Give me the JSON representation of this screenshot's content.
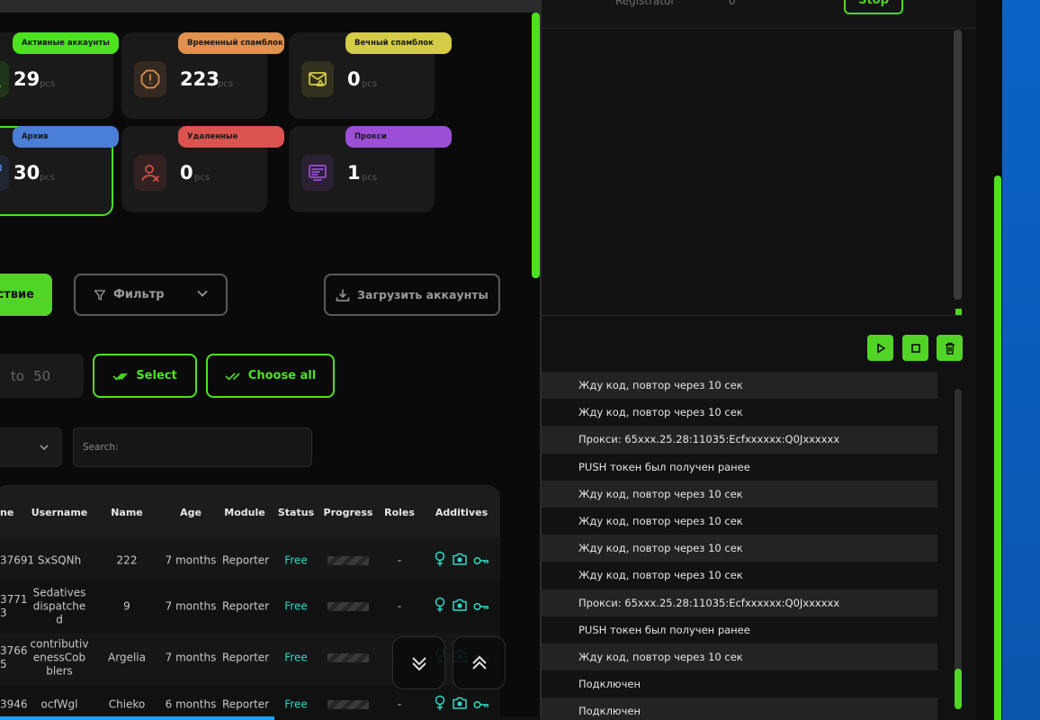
{
  "background_window": {
    "header_col_label": "Registrator",
    "header_col_value": "0",
    "stop_label": "Stop",
    "controls": {
      "play": "play-icon",
      "stop": "stop-square-icon",
      "delete": "trash-icon"
    },
    "log_lines": [
      "Жду код, повтор через 10 сек",
      "Жду код, повтор через 10 сек",
      "Прокси: 65xxx.25.28:11035:Ecfxxxxxx:Q0Jxxxxxx",
      "PUSH токен был получен ранее",
      "Жду код, повтор через 10 сек",
      "Жду код, повтор через 10 сек",
      "Жду код, повтор через 10 сек",
      "Жду код, повтор через 10 сек",
      "Прокси: 65xxx.25.28:11035:Ecfxxxxxx:Q0Jxxxxxx",
      "PUSH токен был получен ранее",
      "Жду код, повтор через 10 сек",
      "Подключен",
      "Подключен"
    ]
  },
  "stats": [
    {
      "label": "Активные аккаунты",
      "value": "29",
      "unit": "pcs",
      "color": "#4be31f",
      "icon": "user-icon"
    },
    {
      "label": "Временный спамблок",
      "value": "223",
      "unit": "pcs",
      "color": "#e0914e",
      "icon": "warning-octagon-icon"
    },
    {
      "label": "Вечный спамблок",
      "value": "0",
      "unit": "pcs",
      "color": "#d4cc47",
      "icon": "mail-warning-icon"
    },
    {
      "label": "Архив",
      "value": "30",
      "unit": "pcs",
      "color": "#4b7ed6",
      "icon": "archive-icon"
    },
    {
      "label": "Удаленные",
      "value": "0",
      "unit": "pcs",
      "color": "#d9534f",
      "icon": "user-remove-icon"
    },
    {
      "label": "Прокси",
      "value": "1",
      "unit": "pcs",
      "color": "#9c4fd6",
      "icon": "proxy-server-icon"
    }
  ],
  "toolbar": {
    "action_label": "ствие",
    "filter_label": "Фильтр",
    "upload_label": "Загрузить аккаунты"
  },
  "range": {
    "to_label": "to",
    "to_value": "50"
  },
  "select_label": "Select",
  "choose_all_label": "Choose all",
  "search": {
    "placeholder": "Search:"
  },
  "table": {
    "columns": [
      "ne",
      "Username",
      "Name",
      "Age",
      "Module",
      "Status",
      "Progress",
      "Roles",
      "Additives"
    ],
    "rows": [
      {
        "id": "37691",
        "username": "SxSQNh",
        "name": "222",
        "age": "7 months",
        "module": "Reporter",
        "status": "Free",
        "roles": "-"
      },
      {
        "id": "3771\n3",
        "username": "Sedatives\ndispatche\nd",
        "name": "9",
        "age": "7 months",
        "module": "Reporter",
        "status": "Free",
        "roles": "-"
      },
      {
        "id": "3766\n5",
        "username": "contributiv\nenessCob\nblers",
        "name": "Argelia",
        "age": "7 months",
        "module": "Reporter",
        "status": "Free",
        "roles": "-"
      },
      {
        "id": "3946",
        "username": "ocfWgl",
        "name": "Chieko",
        "age": "6 months",
        "module": "Reporter",
        "status": "Free",
        "roles": "-"
      }
    ]
  },
  "colors": {
    "accent": "#4be31f",
    "status_free": "#2fd7c5",
    "desktop": "#0b63c6"
  }
}
